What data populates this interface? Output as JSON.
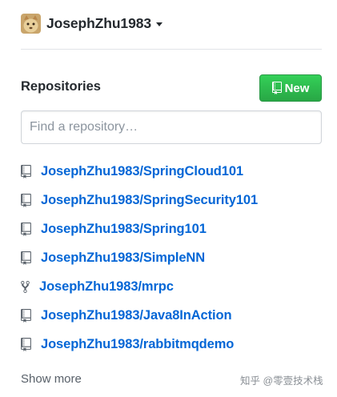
{
  "account": {
    "name": "JosephZhu1983",
    "avatar_icon": "user-avatar",
    "caret_icon": "caret-down-icon"
  },
  "repositories": {
    "title": "Repositories",
    "new_button": {
      "label": "New",
      "icon": "repo-icon"
    },
    "search": {
      "placeholder": "Find a repository…",
      "value": ""
    },
    "items": [
      {
        "name": "JosephZhu1983/SpringCloud101",
        "type": "repo"
      },
      {
        "name": "JosephZhu1983/SpringSecurity101",
        "type": "repo"
      },
      {
        "name": "JosephZhu1983/Spring101",
        "type": "repo"
      },
      {
        "name": "JosephZhu1983/SimpleNN",
        "type": "repo"
      },
      {
        "name": "JosephZhu1983/mrpc",
        "type": "fork"
      },
      {
        "name": "JosephZhu1983/Java8InAction",
        "type": "repo"
      },
      {
        "name": "JosephZhu1983/rabbitmqdemo",
        "type": "repo"
      }
    ],
    "show_more": "Show more"
  },
  "watermark": "知乎 @零壹技术栈",
  "colors": {
    "link": "#0366d6",
    "button_green": "#28a745",
    "text": "#24292e",
    "muted": "#586069"
  }
}
